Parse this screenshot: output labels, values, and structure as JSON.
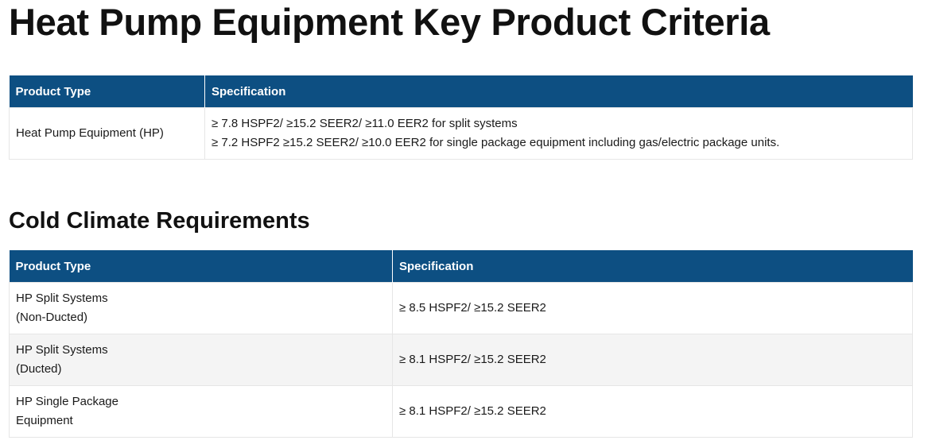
{
  "page": {
    "title": "Heat Pump Equipment Key Product Criteria"
  },
  "table1": {
    "headers": [
      "Product Type",
      "Specification"
    ],
    "rows": [
      {
        "product_type": "Heat Pump Equipment (HP)",
        "specification_lines": [
          "≥ 7.8 HSPF2/ ≥15.2 SEER2/ ≥11.0 EER2 for split systems",
          "≥ 7.2 HSPF2 ≥15.2 SEER2/ ≥10.0 EER2 for single package equipment including gas/electric package units."
        ]
      }
    ]
  },
  "section2": {
    "title": "Cold Climate Requirements"
  },
  "table2": {
    "headers": [
      "Product Type",
      "Specification"
    ],
    "rows": [
      {
        "product_type_lines": [
          "HP Split Systems",
          "(Non-Ducted)"
        ],
        "specification": "≥ 8.5 HSPF2/ ≥15.2 SEER2"
      },
      {
        "product_type_lines": [
          "HP Split Systems",
          "(Ducted)"
        ],
        "specification": "≥ 8.1 HSPF2/ ≥15.2 SEER2"
      },
      {
        "product_type_lines": [
          "HP Single Package",
          "Equipment"
        ],
        "specification": "≥ 8.1 HSPF2/ ≥15.2 SEER2"
      }
    ]
  }
}
